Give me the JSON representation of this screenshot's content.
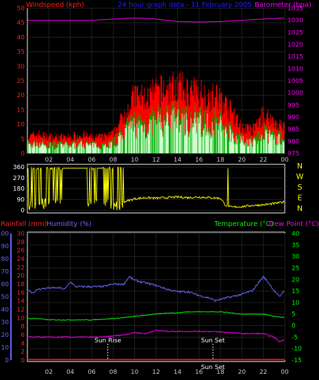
{
  "header": {
    "left": "Windspeed (kph)",
    "center": "24 hour graph data - 11 February 2005",
    "right": "Barometer (hpa)"
  },
  "panel2": {
    "dir_labels": [
      "N",
      "W",
      "S",
      "E",
      "N"
    ],
    "left_ticks": [
      "360",
      "270",
      "180",
      "90",
      "0"
    ]
  },
  "panel3": {
    "label_rain": "Rainfall (mm)",
    "label_humidity": "Humidity (%)",
    "label_temp": "Temperature (°C)",
    "label_dew": "Dew Point (°C)",
    "sunrise_label": "Sun Rise",
    "sunset_label": "Sun Set",
    "sunset_bottom_label": "Sun Set"
  },
  "colors": {
    "wind_max": "#ff0000",
    "wind_avg": "#ccffcc",
    "wind_green": "#00aa00",
    "barometer": "#ff00ff",
    "direction": "#ffff00",
    "humidity": "#6a6aff",
    "temperature": "#00ff00",
    "dewpoint": "#ff00ff",
    "rainfall": "#ff0000"
  },
  "chart_data": [
    {
      "type": "area",
      "title": "24 hour graph data - 11 February 2005",
      "x_ticks": [
        "02",
        "04",
        "06",
        "08",
        "10",
        "12",
        "14",
        "16",
        "18",
        "20",
        "22",
        "00"
      ],
      "y_left_label": "Windspeed (kph)",
      "y_left_ticks": [
        0,
        5,
        10,
        15,
        20,
        25,
        30,
        35,
        40,
        45,
        50
      ],
      "ylim_left": [
        0,
        50
      ],
      "y_right_label": "Barometer (hpa)",
      "y_right_ticks": [
        975,
        980,
        985,
        990,
        995,
        1000,
        1005,
        1010,
        1015,
        1020,
        1025,
        1030,
        1035
      ],
      "ylim_right": [
        975,
        1035
      ],
      "series": [
        {
          "name": "Windspeed (kph)",
          "hours": [
            0,
            1,
            2,
            3,
            4,
            5,
            6,
            7,
            8,
            9,
            10,
            11,
            12,
            13,
            14,
            15,
            16,
            17,
            18,
            19,
            20,
            21,
            22,
            23,
            24
          ],
          "values": [
            5,
            6,
            5,
            5,
            5,
            6,
            5,
            5,
            6,
            12,
            18,
            17,
            19,
            20,
            21,
            19,
            19,
            18,
            17,
            13,
            8,
            7,
            12,
            10,
            8
          ]
        },
        {
          "name": "Barometer (hpa)",
          "hours": [
            0,
            2,
            4,
            6,
            8,
            10,
            12,
            14,
            16,
            18,
            20,
            22,
            24
          ],
          "values": [
            1030,
            1030,
            1030,
            1030,
            1030.5,
            1031,
            1030.5,
            1029.5,
            1029.3,
            1029.5,
            1030,
            1030.5,
            1031
          ]
        }
      ]
    },
    {
      "type": "line",
      "x_ticks": [
        "02",
        "04",
        "06",
        "08",
        "10",
        "12",
        "14",
        "16",
        "18",
        "20",
        "22",
        "00"
      ],
      "y_ticks": [
        0,
        90,
        180,
        270,
        360
      ],
      "ylim": [
        0,
        360
      ],
      "series": [
        {
          "name": "Wind direction",
          "hours": [
            9,
            10,
            11,
            12,
            13,
            14,
            15,
            16,
            17,
            18,
            18.5,
            19,
            20,
            21,
            22,
            23,
            24
          ],
          "values": [
            70,
            95,
            105,
            100,
            105,
            110,
            105,
            110,
            105,
            100,
            40,
            25,
            30,
            40,
            45,
            55,
            70
          ]
        }
      ]
    },
    {
      "type": "line",
      "x_ticks": [
        "02",
        "04",
        "06",
        "08",
        "10",
        "12",
        "14",
        "16",
        "18",
        "20",
        "22",
        "00"
      ],
      "y_humidity_ticks": [
        0,
        10,
        20,
        30,
        40,
        50,
        60,
        70,
        80,
        90,
        100
      ],
      "ylim_humidity": [
        0,
        100
      ],
      "y_rain_ticks": [
        0,
        2,
        4,
        6,
        8,
        10,
        12,
        14,
        16,
        18,
        20,
        22,
        24,
        26,
        28,
        30
      ],
      "ylim_rain": [
        0,
        30
      ],
      "y_temp_ticks": [
        -15,
        -10,
        -5,
        0,
        5,
        10,
        15,
        20,
        25,
        30,
        35,
        40
      ],
      "ylim_temp": [
        -15,
        40
      ],
      "series": [
        {
          "name": "Humidity (%)",
          "hours": [
            0,
            0.5,
            1,
            2,
            3,
            3.5,
            4,
            4.5,
            5,
            6,
            7,
            8,
            9,
            9.5,
            10,
            11,
            12,
            13,
            14,
            15,
            16,
            17,
            17.5,
            18,
            19,
            20,
            21,
            22,
            22.5,
            23,
            23.5,
            24
          ],
          "values": [
            56,
            53,
            56,
            57,
            57,
            56,
            62,
            58,
            58,
            58,
            58,
            60,
            60,
            66,
            63,
            61,
            59,
            56,
            54,
            54,
            51,
            49,
            47,
            48,
            50,
            52,
            55,
            66,
            61,
            55,
            50,
            56
          ]
        },
        {
          "name": "Temperature (°C)",
          "hours": [
            0,
            1,
            2,
            3,
            4,
            5,
            6,
            7,
            8,
            9,
            10,
            11,
            12,
            13,
            14,
            15,
            16,
            17,
            18,
            19,
            20,
            21,
            22,
            23,
            24
          ],
          "values": [
            3,
            3,
            2.5,
            2.5,
            2.5,
            2.5,
            2.5,
            2.8,
            3,
            3.5,
            4,
            4.5,
            5,
            5.5,
            5.5,
            6,
            6,
            6,
            6,
            5.5,
            5,
            5,
            5,
            4,
            3.5
          ]
        },
        {
          "name": "Dew Point (°C)",
          "hours": [
            0,
            1,
            2,
            3,
            4,
            5,
            6,
            7,
            8,
            9,
            10,
            11,
            12,
            13,
            14,
            15,
            16,
            17,
            18,
            19,
            20,
            21,
            22,
            23,
            23.5,
            24
          ],
          "values": [
            -5,
            -5,
            -5,
            -5,
            -5,
            -5,
            -5,
            -5,
            -4.5,
            -4,
            -3,
            -3.5,
            -2,
            -2.5,
            -2.5,
            -2.5,
            -2.5,
            -2.5,
            -2.8,
            -3,
            -3.5,
            -3.5,
            -3.5,
            -5,
            -7,
            -6
          ]
        },
        {
          "name": "Rainfall (mm)",
          "hours": [
            0,
            24
          ],
          "values": [
            0,
            0
          ]
        }
      ],
      "annotations": [
        {
          "label": "Sun Rise",
          "hour": 7.5
        },
        {
          "label": "Sun Set",
          "hour": 17.3
        }
      ]
    }
  ]
}
